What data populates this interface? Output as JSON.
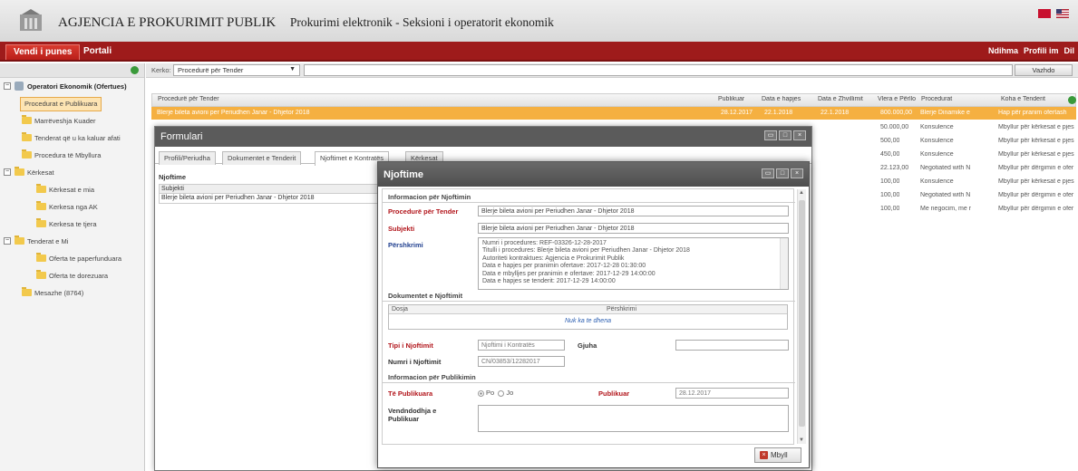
{
  "header": {
    "title": "AGJENCIA E PROKURIMIT PUBLIK",
    "subtitle": "Prokurimi elektronik - Seksioni i operatorit ekonomik"
  },
  "nav": {
    "tabs": [
      "Vendi i punes",
      "Portali"
    ],
    "right_links": [
      "Ndihma",
      "Profili im",
      "Dil"
    ]
  },
  "sidebar": {
    "root": "Operatori Ekonomik (Ofertues)",
    "items": [
      {
        "label": "Procedurat e Publikuara",
        "level": 1,
        "selected": true
      },
      {
        "label": "Marrëveshja Kuader",
        "level": 1
      },
      {
        "label": "Tenderat që u ka kaluar afati",
        "level": 1
      },
      {
        "label": "Procedura të Mbyllura",
        "level": 1
      },
      {
        "label": "Kërkesat",
        "level": 0,
        "expandable": true
      },
      {
        "label": "Kërkesat e mia",
        "level": 2
      },
      {
        "label": "Kerkesa nga AK",
        "level": 2
      },
      {
        "label": "Kerkesa te tjera",
        "level": 2
      },
      {
        "label": "Tenderat e Mi",
        "level": 0,
        "expandable": true
      },
      {
        "label": "Oferta te paperfunduara",
        "level": 2
      },
      {
        "label": "Oferta te dorezuara",
        "level": 2
      },
      {
        "label": "Mesazhe (8764)",
        "level": 1
      }
    ]
  },
  "search": {
    "label": "Kerko:",
    "selected": "Procedurë për Tender",
    "button": "Vazhdo"
  },
  "grid": {
    "headers": [
      "Procedurë për Tender",
      "Publikuar",
      "Data e hapjes",
      "Data e Zhvillimit",
      "Vlera e Përllo",
      "Procedurat",
      "Koha e Tenderit"
    ],
    "selected_row": {
      "title": "Blerje bileta avioni per Periudhen Janar - Dhjetor 2018",
      "publikuar": "28.12.2017",
      "hapjes": "22.1.2018",
      "zhvillimit": "22.1.2018",
      "vlera": "800.000,00",
      "procedura": "Blerje Dinamike e",
      "koha": "Hap për pranim ofertash"
    },
    "rows": [
      {
        "vlera": "50.000,00",
        "procedura": "Konsulence",
        "koha": "Mbyllur për kërkesat e pjes"
      },
      {
        "vlera": "500,00",
        "procedura": "Konsulence",
        "koha": "Mbyllur për kërkesat e pjes"
      },
      {
        "vlera": "450,00",
        "procedura": "Konsulence",
        "koha": "Mbyllur për kërkesat e pjes"
      },
      {
        "vlera": "22.123,00",
        "procedura": "Negotiated with N",
        "koha": "Mbyllur për dërgimin e ofer"
      },
      {
        "vlera": "100,00",
        "procedura": "Konsulence",
        "koha": "Mbyllur për kërkesat e pjes"
      },
      {
        "vlera": "100,00",
        "procedura": "Negotiated with N",
        "koha": "Mbyllur për dërgimin e ofer"
      },
      {
        "vlera": "100,00",
        "procedura": "Me negocim, me r",
        "koha": "Mbyllur për dërgimin e ofer"
      }
    ]
  },
  "formulari": {
    "title": "Formulari",
    "tabs": [
      "Profili/Periudha",
      "Dokumentet e Tenderit",
      "Njoftimet e Kontratës",
      "Kërkesat"
    ],
    "list_header": "Njoftime",
    "list_col": "Subjekti",
    "list_row": "Blerje bileta avioni per Periudhen Janar - Dhjetor 2018"
  },
  "njoftime": {
    "title": "Njoftime",
    "section_info": "Informacion për Njoftimin",
    "procedure_label": "Procedurë për Tender",
    "procedure_value": "Blerje bileta avioni per Periudhen Janar - Dhjetor 2018",
    "subject_label": "Subjekti",
    "subject_value": "Blerje bileta avioni per Periudhen Janar - Dhjetor 2018",
    "desc_label": "Përshkrimi",
    "desc_lines": [
      "Numri i procedures: REF-03326-12-28-2017",
      "Titulli i procedures: Blerje bileta avioni per Periudhen Janar - Dhjetor 2018",
      "Autoriteti kontraktues: Agjencia e Prokurimit Publik",
      "Data e hapjes per pranimin ofertave: 2017-12-28 01:30:00",
      "Data e mbylljes per pranimin e ofertave: 2017-12-29 14:00:00",
      "Data e hapjes se tenderit: 2017-12-29 14:00:00"
    ],
    "docs_section": "Dokumentet e Njoftimit",
    "docs_col1": "Dosja",
    "docs_col2": "Përshkrimi",
    "docs_empty": "Nuk ka te dhena",
    "type_label": "Tipi i Njoftimit",
    "type_value": "Njoftimi i Kontratës",
    "lang_label": "Gjuha",
    "number_label": "Numri i Njoftimit",
    "number_value": "CN/03853/12282017",
    "pub_section": "Informacion për Publikimin",
    "published_label": "Të Publikuara",
    "radio_yes": "Po",
    "radio_no": "Jo",
    "pub_date_label": "Publikuar",
    "pub_date_value": "28.12.2017",
    "place_label_1": "Vendndodhja e",
    "place_label_2": "Publikuar",
    "close_button": "Mbyll"
  }
}
